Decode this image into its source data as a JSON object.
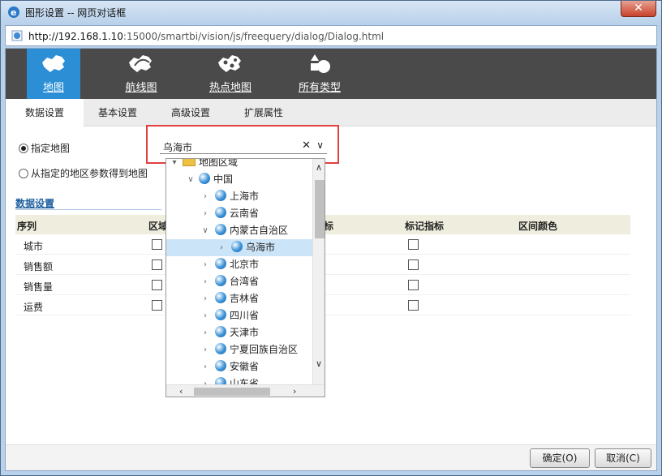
{
  "window": {
    "title": "图形设置 -- 网页对话框",
    "close_label": "✕"
  },
  "address": {
    "host": "http://192.168.1.10",
    "path": ":15000/smartbi/vision/js/freequery/dialog/Dialog.html"
  },
  "chart_types": [
    {
      "label": "地图",
      "icon": "china-map-icon",
      "active": true
    },
    {
      "label": "航线图",
      "icon": "route-map-icon",
      "active": false
    },
    {
      "label": "热点地图",
      "icon": "hotspot-map-icon",
      "active": false
    },
    {
      "label": "所有类型",
      "icon": "all-types-icon",
      "active": false
    }
  ],
  "tabs": [
    "数据设置",
    "基本设置",
    "高级设置",
    "扩展属性"
  ],
  "map_source": {
    "option1": "指定地图",
    "option2": "从指定的地区参数得到地图",
    "selected_value": "乌海市"
  },
  "data_section": {
    "title": "数据设置",
    "columns": [
      "序列",
      "区域",
      "标",
      "标记指标",
      "区间颜色"
    ],
    "rows": [
      "城市",
      "销售额",
      "销售量",
      "运费"
    ]
  },
  "tree": {
    "root": "地图区域",
    "country": "中国",
    "items": [
      "上海市",
      "云南省",
      "内蒙古自治区",
      "乌海市",
      "北京市",
      "台湾省",
      "吉林省",
      "四川省",
      "天津市",
      "宁夏回族自治区",
      "安徽省",
      "山东省"
    ]
  },
  "buttons": {
    "ok": "确定(O)",
    "cancel": "取消(C)"
  }
}
